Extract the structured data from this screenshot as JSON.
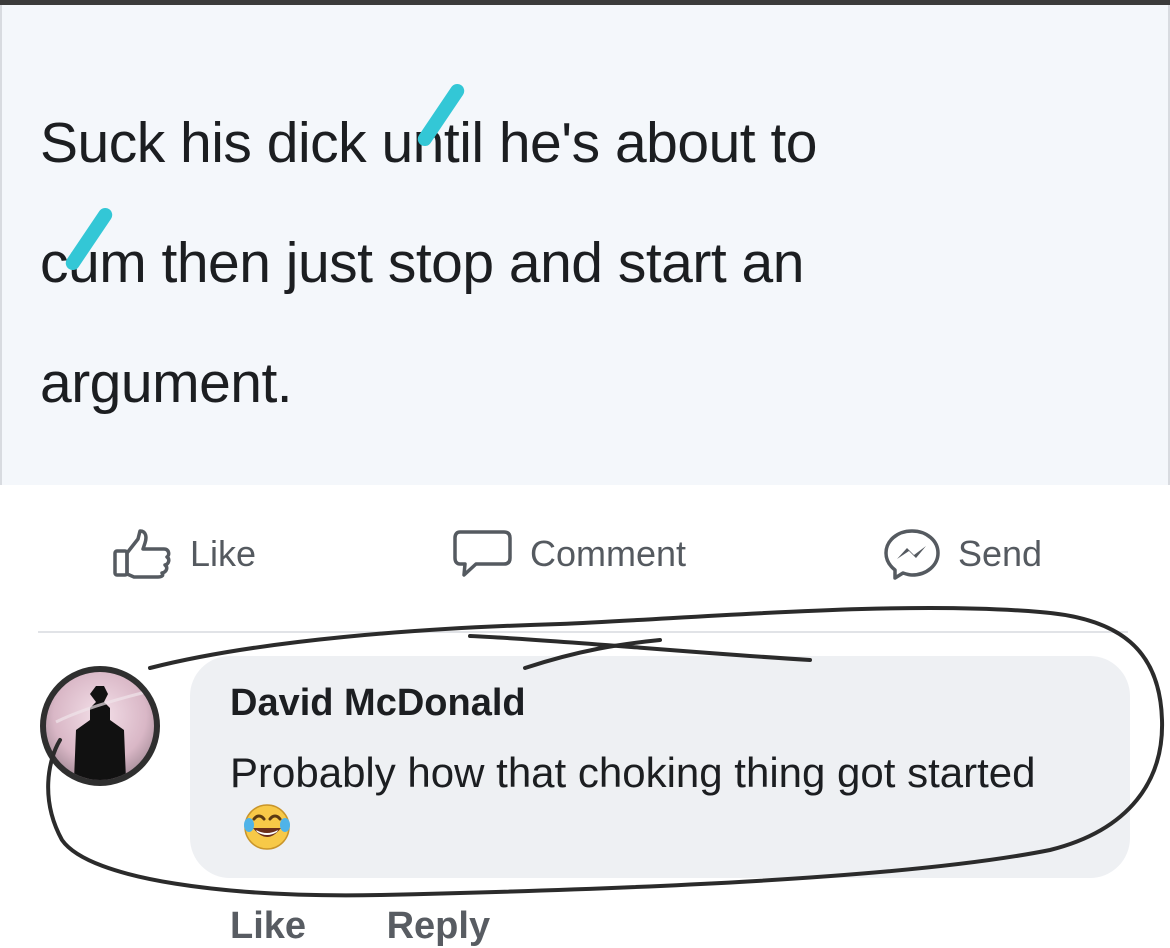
{
  "post": {
    "lines": [
      "Suck his dick until he's about to",
      "cum then just stop and start an",
      "argument."
    ]
  },
  "actions": {
    "like_label": "Like",
    "comment_label": "Comment",
    "send_label": "Send"
  },
  "comment": {
    "author": "David McDonald",
    "text": "Probably how that choking thing got started",
    "emoji": "laughing-tears-emoji",
    "like_label": "Like",
    "reply_label": "Reply"
  },
  "icons": {
    "like": "thumbs-up-icon",
    "comment": "speech-bubble-icon",
    "send": "messenger-icon"
  },
  "colors": {
    "censor_mark": "#33c7d6",
    "post_background": "#f4f7fb",
    "comment_bubble": "#eef0f3",
    "action_text": "#555a60"
  }
}
